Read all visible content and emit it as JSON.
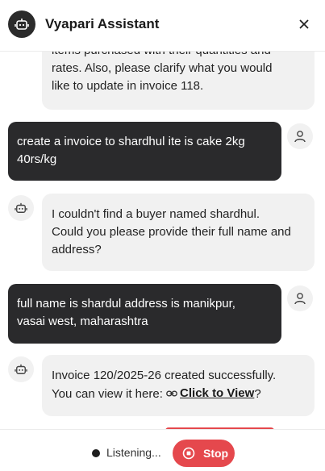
{
  "header": {
    "title": "Vyapari Assistant",
    "avatar_icon": "robot-icon",
    "close_icon": "close-icon"
  },
  "messages": [
    {
      "role": "assistant",
      "lines": [
        "items purchased with their quantities and",
        "rates.  Also, please clarify what you would",
        "like to update in invoice 118."
      ]
    },
    {
      "role": "user",
      "lines": [
        "create a invoice to shardhul ite is cake 2kg",
        "40rs/kg"
      ]
    },
    {
      "role": "assistant",
      "lines": [
        "I couldn't find a buyer named shardhul.",
        "Could you please provide their full name and",
        "address?"
      ]
    },
    {
      "role": "user",
      "lines": [
        "full name is shardul address is manikpur,",
        "vasai west, maharashtra"
      ]
    },
    {
      "role": "assistant",
      "line1": "Invoice 120/2025-26 created successfully.",
      "line2_prefix": "You can view it here:",
      "link_text": "Click to View",
      "line2_suffix": "?",
      "link_icon": "link-icon"
    }
  ],
  "footer": {
    "status": "Listening...",
    "stop_label": "Stop",
    "stop_icon": "stop-circle-icon"
  },
  "colors": {
    "user_bubble": "#2a2a2c",
    "bot_bubble": "#f1f1f1",
    "stop_button": "#e5484d"
  }
}
